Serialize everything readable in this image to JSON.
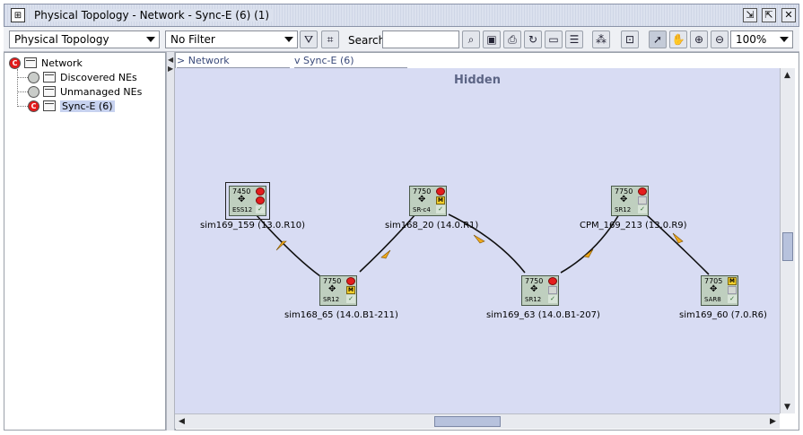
{
  "window": {
    "title": "Physical Topology - Network - Sync-E (6) (1)",
    "icon": "topology-window-icon",
    "buttons": [
      "restore-icon",
      "maximize-icon",
      "close-icon"
    ]
  },
  "toolbar": {
    "view_select": "Physical Topology",
    "filter_select": "No Filter",
    "search_label": "Search",
    "search_value": "",
    "zoom_value": "100%",
    "icons": [
      "filter-icon",
      "filter-edit-icon",
      "find-icon",
      "save-icon",
      "print-icon",
      "refresh-icon",
      "window-icon",
      "properties-icon",
      "layout-icon",
      "fit-icon",
      "pointer-icon",
      "pan-hand-icon",
      "zoom-in-icon",
      "zoom-out-icon"
    ]
  },
  "tree": {
    "root": {
      "label": "Network",
      "status": "red",
      "badge": "C"
    },
    "children": [
      {
        "label": "Discovered NEs",
        "status": "grey",
        "badge": "",
        "selected": false
      },
      {
        "label": "Unmanaged NEs",
        "status": "grey",
        "badge": "",
        "selected": false
      },
      {
        "label": "Sync-E (6)",
        "status": "red",
        "badge": "C",
        "selected": true
      }
    ]
  },
  "breadcrumb": [
    {
      "label": "Network",
      "marker": ">"
    },
    {
      "label": "Sync-E (6)",
      "marker": "v"
    }
  ],
  "canvas": {
    "title": "Hidden"
  },
  "nodes": [
    {
      "id": "n1",
      "model": "7450",
      "type": "ESS12",
      "label": "sim169_159 (13.0.R10)",
      "indicators": [
        "red",
        "red",
        "check"
      ]
    },
    {
      "id": "n2",
      "model": "7750",
      "type": "SR-c4",
      "label": "sim168_20 (14.0.R1)",
      "indicators": [
        "red",
        "M",
        "check"
      ]
    },
    {
      "id": "n3",
      "model": "7750",
      "type": "SR12",
      "label": "CPM_169_213 (13.0.R9)",
      "indicators": [
        "red",
        "grey",
        "check"
      ]
    },
    {
      "id": "n4",
      "model": "7750",
      "type": "SR12",
      "label": "sim168_65 (14.0.B1-211)",
      "indicators": [
        "red",
        "M",
        "check"
      ]
    },
    {
      "id": "n5",
      "model": "7750",
      "type": "SR12",
      "label": "sim169_63 (14.0.B1-207)",
      "indicators": [
        "red",
        "grey",
        "check"
      ]
    },
    {
      "id": "n6",
      "model": "7705",
      "type": "SAR8",
      "label": "sim169_60 (7.0.R6)",
      "indicators": [
        "M",
        "grey",
        "check"
      ]
    }
  ],
  "colors": {
    "canvas_bg": "#d8dcf3",
    "link": "#111111",
    "arrow": "#f0a91c",
    "node_bg": "#bfcfbf",
    "selection": "#c7d2ef"
  }
}
